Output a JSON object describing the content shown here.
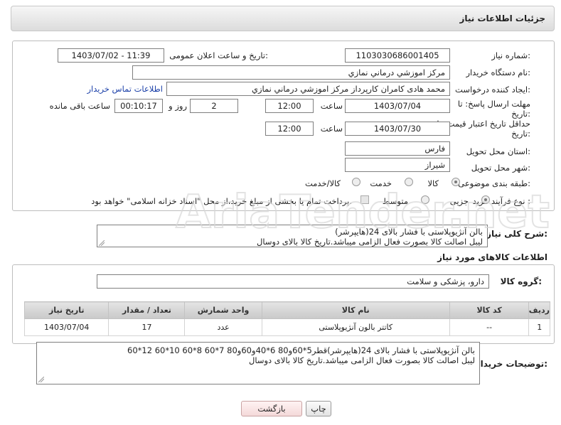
{
  "header": {
    "title": "جزئیات اطلاعات نیاز"
  },
  "info": {
    "need_number_label": "شماره نیاز:",
    "need_number": "1103030686001405",
    "announce_label": "تاریخ و ساعت اعلان عمومی:",
    "announce_value": "1403/07/02 - 11:39",
    "buyer_org_label": "نام دستگاه خریدار:",
    "buyer_org": "مرکز اموزشي درماني نمازي",
    "creator_label": "ایجاد کننده درخواست:",
    "creator": "محمد هادی کامران کارپرداز مرکز اموزشي درماني نمازي",
    "contact_link": "اطلاعات تماس خریدار",
    "deadline_label_1": "مهلت ارسال پاسخ: تا",
    "deadline_label_2": "تاریخ:",
    "deadline_date": "1403/07/04",
    "time_label": "ساعت",
    "deadline_time": "12:00",
    "days_value": "2",
    "days_label": "روز و",
    "remaining_time": "00:10:17",
    "remaining_label": "ساعت باقی مانده",
    "validity_label_1": "حداقل تاریخ اعتبار قیمت: تا",
    "validity_label_2": "تاریخ:",
    "validity_date": "1403/07/30",
    "validity_time": "12:00",
    "province_label": "استان محل تحویل:",
    "province": "فارس",
    "city_label": "شهر محل تحویل:",
    "city": "شیراز",
    "category_label": "طبقه بندی موضوعی:",
    "category_options": [
      "کالا",
      "خدمت",
      "کالا/خدمت"
    ],
    "category_selected": "کالا",
    "process_label": "نوع فرآیند خرید :",
    "process_options": [
      "جزیی",
      "متوسط"
    ],
    "process_selected": "جزیی",
    "payment_note": "پرداخت تمام یا بخشی از مبلغ خرید،از محل \"اسناد خزانه اسلامی\" خواهد بود."
  },
  "summary": {
    "label": "شرح کلی نیاز:",
    "line1": "بالن آنژیوپلاستی با فشار بالای 24(هایپرشر)",
    "line2": "لیبل اصالت کالا بصورت فعال الزامی میباشد.تاریخ کالا بالای دوسال"
  },
  "goods": {
    "section_title": "اطلاعات کالاهای مورد نیاز",
    "group_label": "گروه کالا:",
    "group_value": "دارو، پزشکی و سلامت",
    "columns": [
      "ردیف",
      "کد کالا",
      "نام کالا",
      "واحد شمارش",
      "تعداد / مقدار",
      "تاریخ نیاز"
    ],
    "rows": [
      {
        "row": "1",
        "code": "--",
        "name": "کاتتر بالون آنژیوپلاستی",
        "unit": "عدد",
        "qty": "17",
        "date": "1403/07/04"
      }
    ]
  },
  "buyer_notes": {
    "label": "توضیحات خریدار:",
    "line1": "بالن آنژیوپلاستی با فشار بالای 24(هایپرشر)قطر5*60و80 6*40و60و80 7*60 8*60 10*60 12*60",
    "line2": "لیبل اصالت کالا بصورت فعال الزامی میباشد.تاریخ کالا بالای دوسال"
  },
  "buttons": {
    "print": "چاپ",
    "back": "بازگشت"
  },
  "watermark": "AriaTender.net",
  "colors": {
    "link": "#1a3fa8",
    "header_bg": "#e6e6e6"
  }
}
